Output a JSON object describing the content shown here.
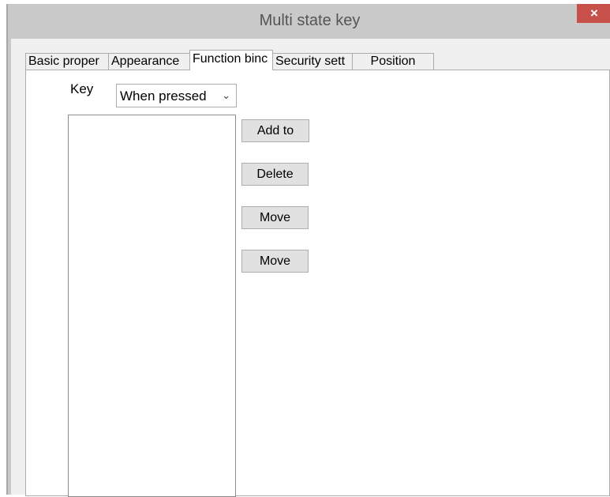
{
  "window": {
    "title": "Multi state key",
    "close_glyph": "×"
  },
  "tabs": [
    {
      "label": "Basic proper",
      "active": false
    },
    {
      "label": "Appearance",
      "active": false
    },
    {
      "label": "Function binc",
      "active": true
    },
    {
      "label": "Security sett",
      "active": false
    },
    {
      "label": "Position",
      "active": false
    }
  ],
  "function_binding": {
    "key_label": "Key",
    "trigger_select": {
      "value": "When pressed",
      "chevron_glyph": "⌄"
    },
    "actions": {
      "add": "Add to",
      "delete": "Delete",
      "move_up": "Move",
      "move_down": "Move"
    },
    "bound_functions": []
  },
  "colors": {
    "close_button": "#c7504a",
    "chrome": "#c9c9c9",
    "panel": "#ffffff"
  }
}
